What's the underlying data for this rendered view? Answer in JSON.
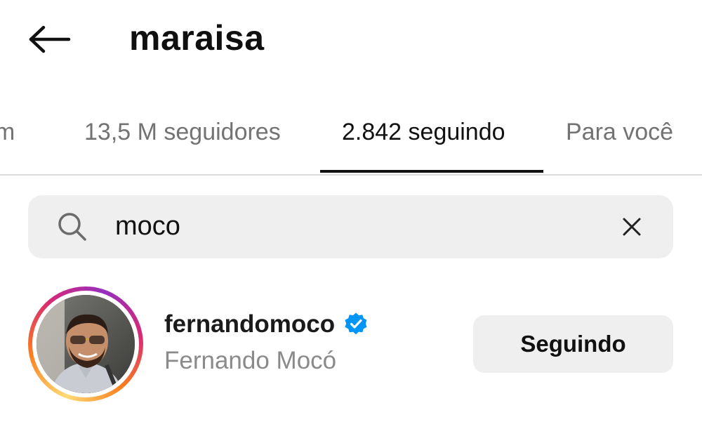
{
  "header": {
    "title": "maraisa",
    "back_icon": "arrow-left-icon"
  },
  "tabs": [
    {
      "label": "um"
    },
    {
      "label": "13,5 M seguidores"
    },
    {
      "label": "2.842 seguindo",
      "active": true
    },
    {
      "label": "Para você"
    }
  ],
  "search": {
    "value": "moco",
    "icon": "search-icon",
    "clear_icon": "close-icon"
  },
  "result": {
    "username": "fernandomoco",
    "full_name": "Fernando Mocó",
    "verified": true,
    "verified_color": "#0095f6",
    "button_label": "Seguindo"
  },
  "colors": {
    "text_primary": "#111111",
    "text_secondary": "#737373",
    "search_bg": "#efefef",
    "button_bg": "#efefef"
  }
}
